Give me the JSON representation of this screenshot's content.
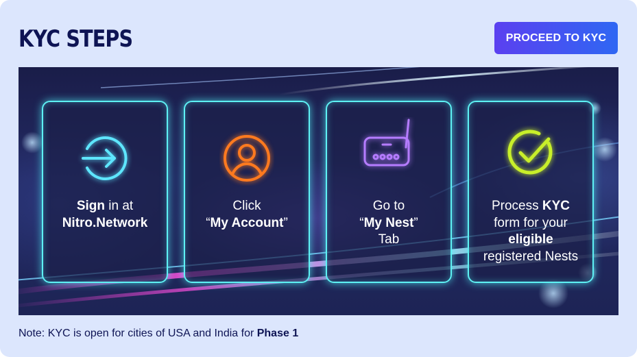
{
  "header": {
    "title": "KYC STEPS",
    "cta_label": "PROCEED TO KYC"
  },
  "steps": [
    {
      "icon": "sign-in-icon",
      "icon_color": "#5ee6ff",
      "line1_bold": "Sign",
      "line1_rest": " in at",
      "line2_bold": "Nitro.Network"
    },
    {
      "icon": "user-account-icon",
      "icon_color": "#ff7a1f",
      "line1": "Click",
      "line2_open": "“",
      "line2_bold": "My Account",
      "line2_close": "”"
    },
    {
      "icon": "router-icon",
      "icon_color": "#b57cff",
      "line1": "Go to",
      "line2_open": "“",
      "line2_bold": "My Nest",
      "line2_close": "”",
      "line3": "Tab"
    },
    {
      "icon": "check-circle-icon",
      "icon_color": "#c8ef2a",
      "line1_rest": "Process ",
      "line1_bold": "KYC",
      "line2": "form for your",
      "line3_bold": "eligible",
      "line4": "registered Nests"
    }
  ],
  "footer": {
    "note_text": "Note: KYC is open for cities of USA and India for ",
    "note_bold": "Phase 1"
  },
  "colors": {
    "panel_bg": "#dce6fd",
    "title": "#0e1454",
    "cta_gradient_start": "#5b40f0",
    "cta_gradient_end": "#2f67f3",
    "card_border": "#5ef1f4"
  }
}
